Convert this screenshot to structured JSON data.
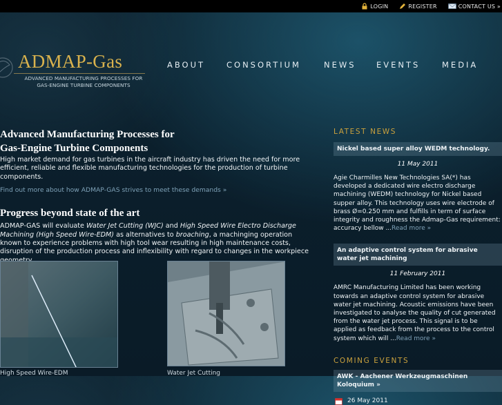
{
  "topbar": {
    "login": "LOGIN",
    "register": "REGISTER",
    "contact": "CONTACT US »",
    "icons": [
      "lock-icon",
      "pencil-icon",
      "envelope-icon"
    ]
  },
  "logo": {
    "title": "ADMAP-Gas",
    "subtitle_line1": "ADVANCED MANUFACTURING PROCESSES FOR",
    "subtitle_line2": "GAS-ENGINE TURBINE COMPONENTS"
  },
  "nav": [
    "ABOUT",
    "CONSORTIUM",
    "NEWS",
    "EVENTS",
    "MEDIA"
  ],
  "main": {
    "heading1_line1": "Advanced Manufacturing Processes for",
    "heading1_line2": "Gas-Engine Turbine Components",
    "para1": "High market demand for gas turbines in the aircraft industry has driven the need for more efficient, reliable and flexible manufacturing technologies for the production of turbine components.",
    "more_link": "Find out more about how ADMAP-GAS strives to meet these demands »",
    "heading2": "Progress beyond state of the art",
    "para2_a": "ADMAP-GAS will evaluate ",
    "para2_wjc": "Water Jet Cutting (WJC)",
    "para2_b": " and ",
    "para2_hsw": "High Speed Wire Electro Discharge Machining (High Speed Wire-EDM)",
    "para2_c": " as alternatives to ",
    "para2_broach": "broaching",
    "para2_d": ", a machinging operation known to experience problems with high tool wear resulting in high maintenance costs, disruption of the production process and inflexibility with regard to changes in the workpiece geometry.",
    "caption1": "High Speed Wire-EDM",
    "caption2": "Water Jet Cutting"
  },
  "sidebar": {
    "latest_news_title": "LATEST NEWS",
    "news": [
      {
        "title": "Nickel based super alloy WEDM technology.",
        "date": "11 May 2011",
        "body": "Agie Charmilles New Technologies SA(*) has developed a dedicated wire electro discharge machining (WEDM) technology for Nickel based supper alloy. This technology uses wire electrode of brass Ø=0.250 mm and fulfills in term of surface integrity and roughness the Admap-Gas requirement: accuracy bellow ...",
        "read_more": "Read more »"
      },
      {
        "title": "An adaptive control system for abrasive water jet machining",
        "date": "11 February 2011",
        "body": "AMRC Manufacturing Limited has been working towards an adaptive control system for abrasive water jet machining. Acoustic emissions have been investigated to analyse the quality of cut generated from the water jet process. This signal is to be applied as feedback from the process to the control system which will ...",
        "read_more": "Read more »"
      }
    ],
    "coming_events_title": "COMING EVENTS",
    "event": {
      "title": "AWK - Aachener Werkzeugmaschinen Koloquium »",
      "date": "26 May 2011"
    }
  },
  "colors": {
    "gold": "#d9b24d",
    "link": "#7fa2b8",
    "section_title": "#caa13d"
  }
}
